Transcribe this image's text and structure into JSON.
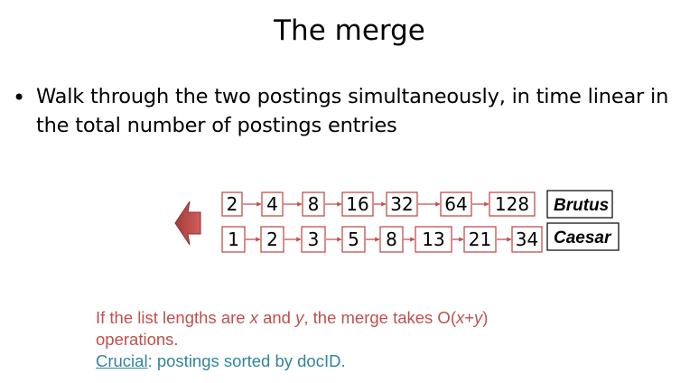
{
  "title": "The merge",
  "bullet": "Walk through the two postings simultaneously, in time linear in the total number of postings entries",
  "lists": [
    {
      "term": "Brutus",
      "postings": [
        "2",
        "4",
        "8",
        "16",
        "32",
        "64",
        "128"
      ]
    },
    {
      "term": "Caesar",
      "postings": [
        "1",
        "2",
        "3",
        "5",
        "8",
        "13",
        "21",
        "34"
      ]
    }
  ],
  "note": {
    "line1_a": "If the list lengths are ",
    "line1_x": "x",
    "line1_b": " and ",
    "line1_y": "y",
    "line1_c": ", the merge takes O(",
    "line1_x2": "x",
    "line1_d": "+",
    "line1_y2": "y",
    "line1_e": ")",
    "line2": "operations.",
    "line3_u": "Crucial",
    "line3_rest": ": postings sorted by docID."
  },
  "colors": {
    "box_border": "#c0504d",
    "arrow": "#c0504d",
    "note_red": "#c0504d",
    "note_green": "#31859c"
  },
  "icons": {
    "merge_arrow": "left-arrow-icon"
  }
}
